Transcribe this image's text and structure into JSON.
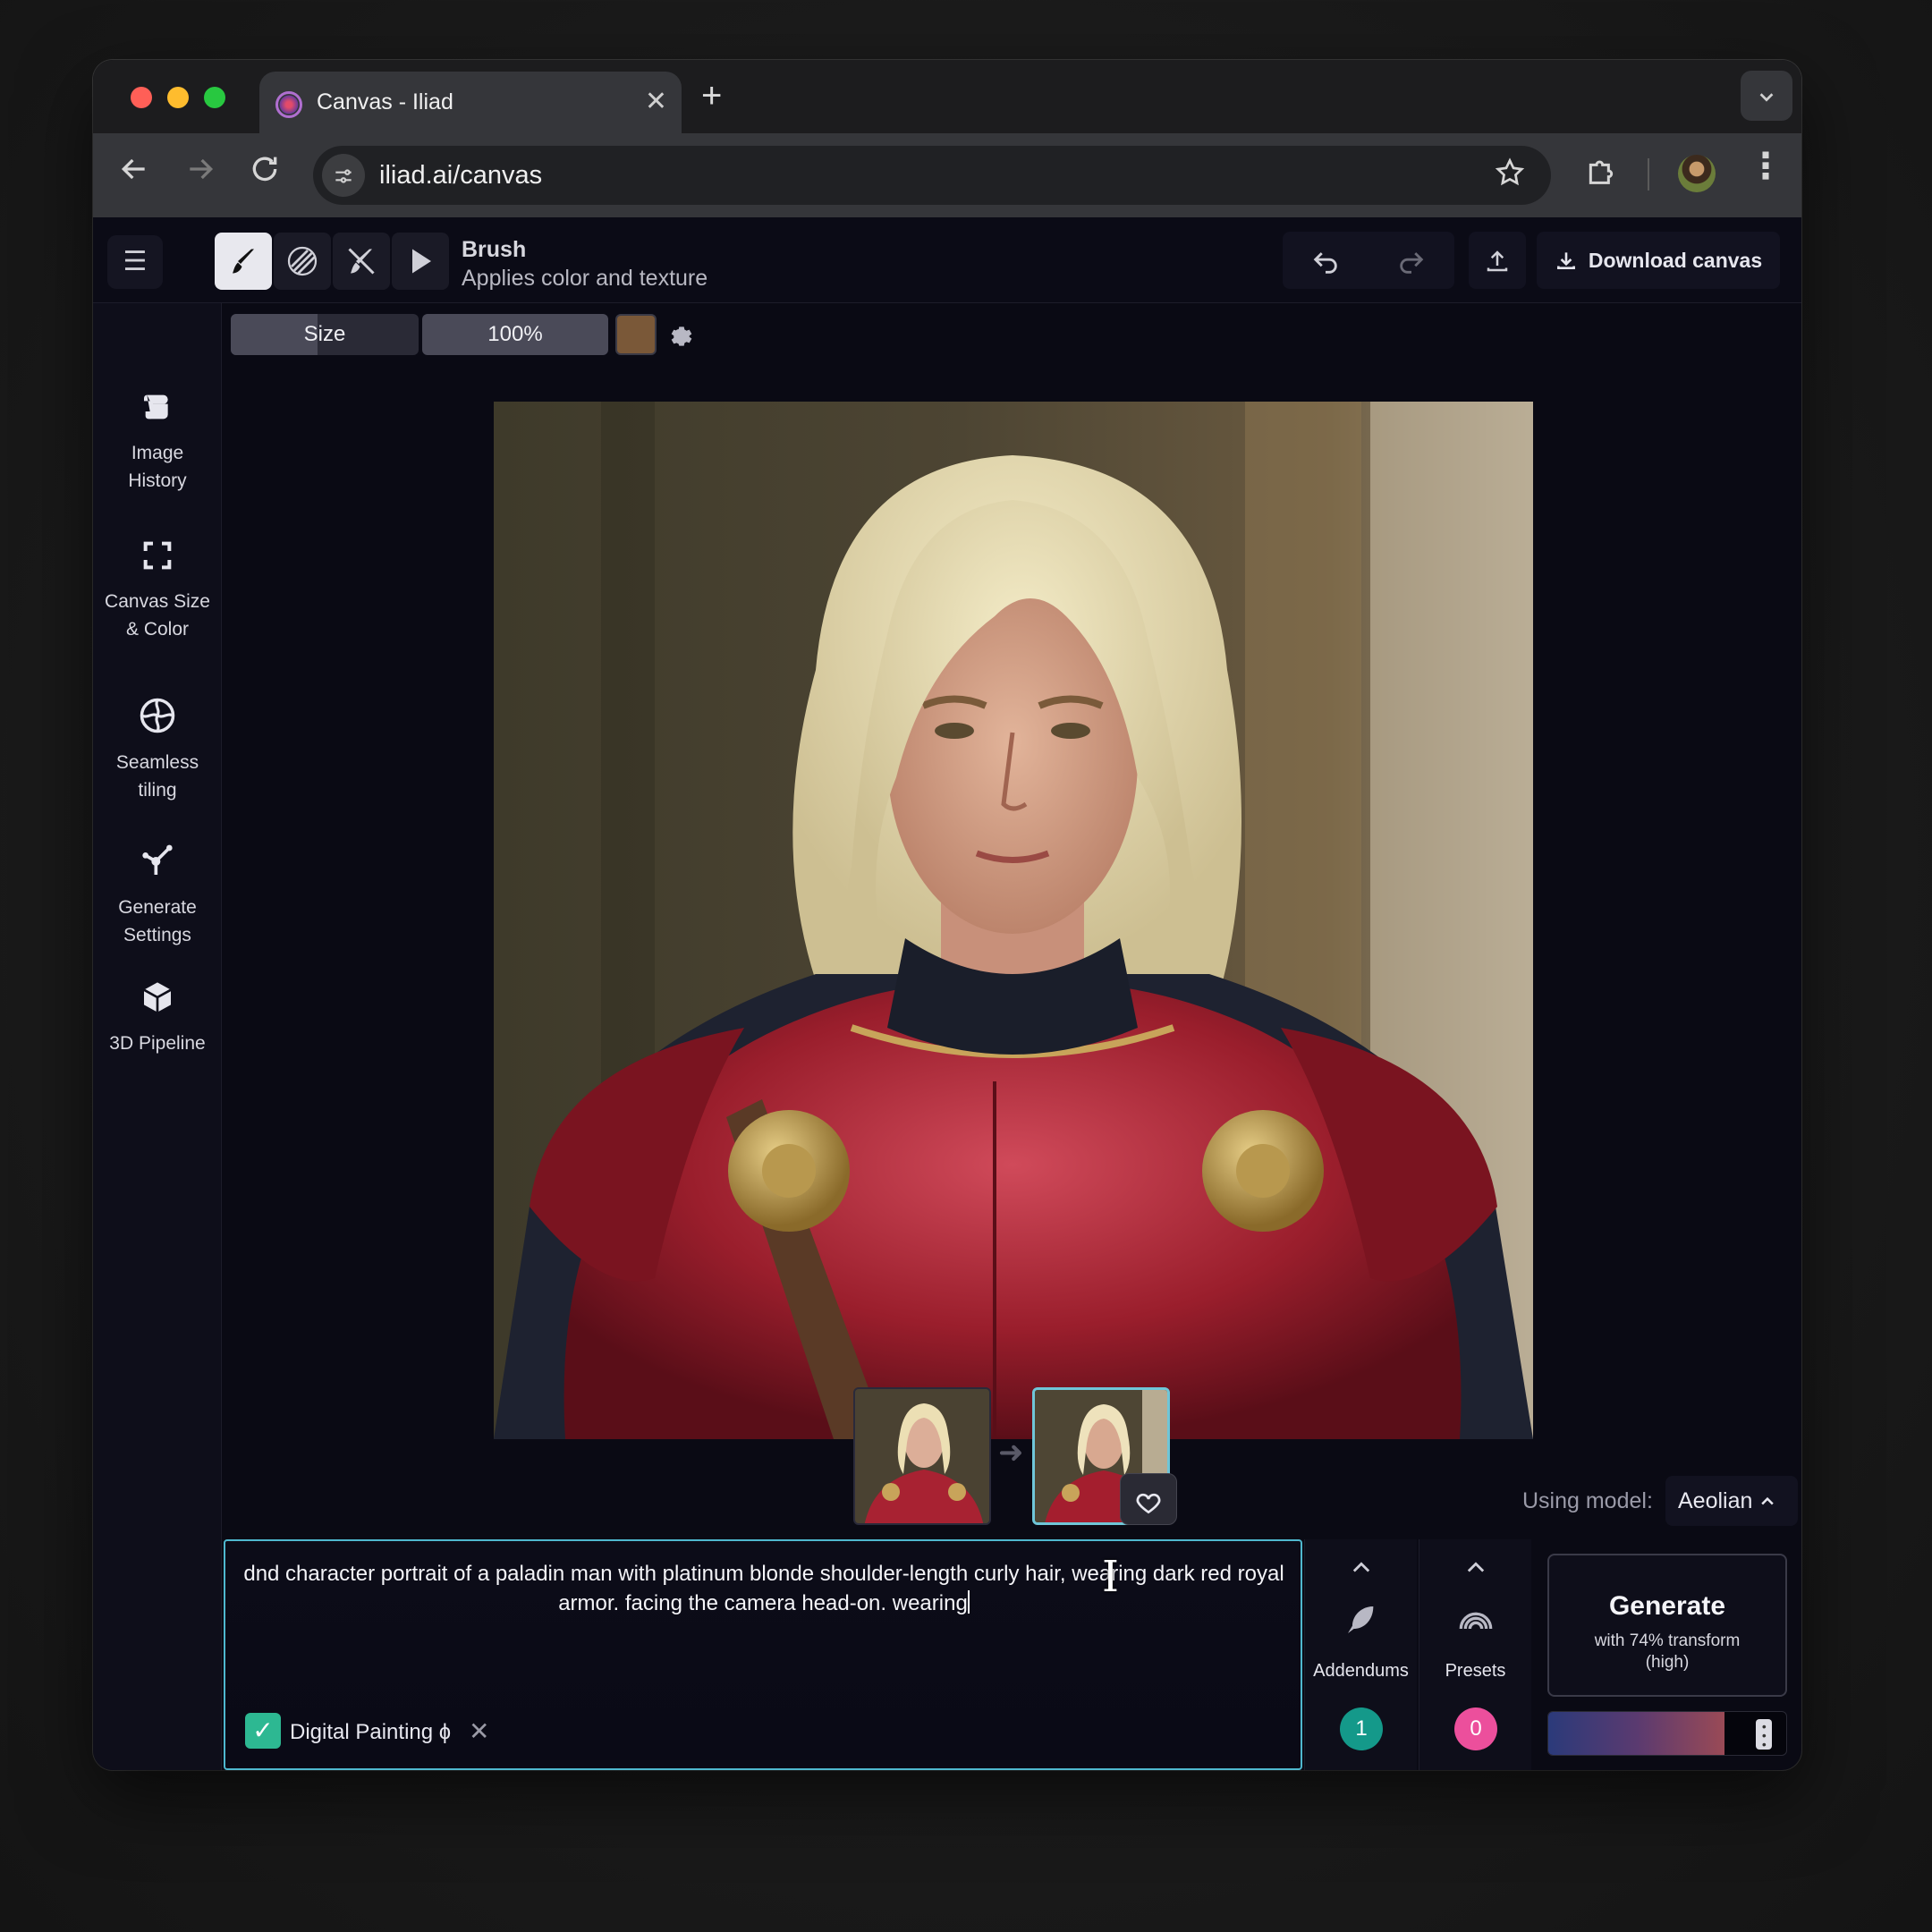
{
  "browser": {
    "tab_title": "Canvas - Iliad",
    "tab_close": "✕",
    "new_tab": "+",
    "tab_menu": "⌄",
    "url": "iliad.ai/canvas",
    "icons": [
      "back-arrow-icon",
      "forward-arrow-icon",
      "reload-icon",
      "site-info-icon",
      "star-icon",
      "extensions-icon",
      "profile-avatar",
      "kebab-menu-icon"
    ]
  },
  "toolbar": {
    "tools": [
      "brush",
      "pattern",
      "eraser",
      "select"
    ],
    "active_tool_name": "Brush",
    "active_tool_desc": "Applies color and texture",
    "download_label": "Download canvas"
  },
  "sidebar": {
    "items": [
      {
        "label": "Image History",
        "icon": "scroll-icon"
      },
      {
        "label": "Canvas Size & Color",
        "icon": "resize-frame-icon"
      },
      {
        "label": "Seamless tiling",
        "icon": "aperture-icon"
      },
      {
        "label": "Generate Settings",
        "icon": "node-graph-icon"
      },
      {
        "label": "3D Pipeline",
        "icon": "cube-icon"
      }
    ]
  },
  "brush_settings": {
    "size_label": "Size",
    "size_fraction": 0.46,
    "opacity_label": "100%",
    "color": "#7a5838"
  },
  "model": {
    "label": "Using model:",
    "value": "Aeolian"
  },
  "prompt": {
    "text": "dnd character portrait of a paladin man with platinum blonde shoulder-length curly hair, wearing dark red royal armor. facing the camera head-on. wearing",
    "style_tag": "Digital Painting ɸ",
    "style_checked": true
  },
  "addendums": {
    "label": "Addendums",
    "count": "1"
  },
  "presets": {
    "label": "Presets",
    "count": "0"
  },
  "generate": {
    "title": "Generate",
    "subtitle": "with 74% transform (high)",
    "transform_fraction": 0.74
  },
  "colors": {
    "accent": "#4fb8cf",
    "addendum_badge": "#14998a",
    "preset_badge": "#ec4f9c",
    "checkbox": "#2db892"
  }
}
